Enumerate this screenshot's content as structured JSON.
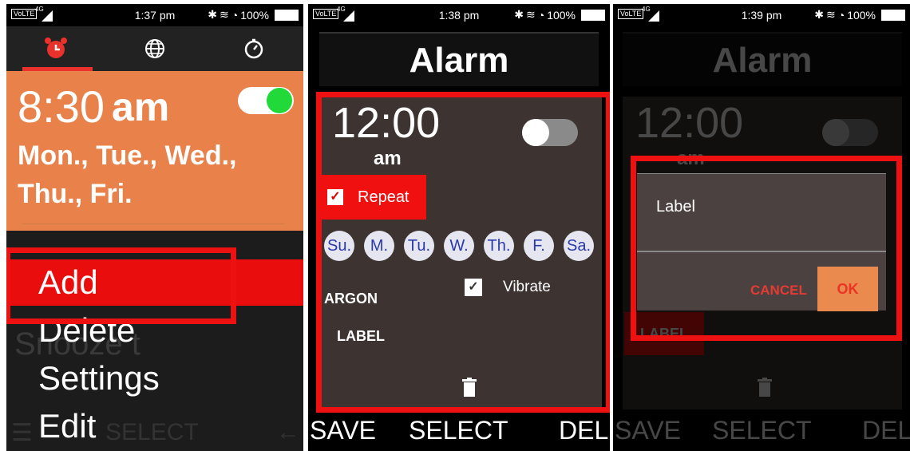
{
  "panels": [
    {
      "status": {
        "volte": "VoLTE",
        "net": "4G",
        "time": "1:37 pm",
        "battery": "100%"
      },
      "tabs": [
        "alarm-icon",
        "globe-icon",
        "stopwatch-icon"
      ],
      "alarm": {
        "time": "8:30",
        "ampm": "am",
        "days": "Mon., Tue., Wed., Thu., Fri.",
        "enabled": true
      },
      "menu": {
        "items": [
          "Add",
          "Delete",
          "Settings",
          "Edit"
        ],
        "ghost_text": "Snooze t",
        "softkey_center": "SELECT"
      }
    },
    {
      "status": {
        "volte": "VoLTE",
        "net": "4G",
        "time": "1:38 pm",
        "battery": "100%"
      },
      "title": "Alarm",
      "time": "12:00",
      "ampm": "am",
      "repeat_label": "Repeat",
      "days": [
        "Su.",
        "M.",
        "Tu.",
        "W.",
        "Th.",
        "F.",
        "Sa."
      ],
      "ringtone": "ARGON",
      "vibrate_label": "Vibrate",
      "label_field": "LABEL",
      "softkeys": {
        "left": "SAVE",
        "center": "SELECT",
        "right": "DEL"
      }
    },
    {
      "status": {
        "volte": "VoLTE",
        "net": "4G",
        "time": "1:39 pm",
        "battery": "100%"
      },
      "title": "Alarm",
      "time": "12:00",
      "ampm": "am",
      "label_field": "LABEL",
      "dialog": {
        "title": "Label",
        "cancel": "CANCEL",
        "ok": "OK"
      },
      "softkeys": {
        "left": "SAVE",
        "center": "SELECT",
        "right": "DEL"
      }
    }
  ],
  "colors": {
    "accent_orange": "#e8824a",
    "highlight_red": "#ea0d0d",
    "toggle_green": "#22d93a"
  }
}
